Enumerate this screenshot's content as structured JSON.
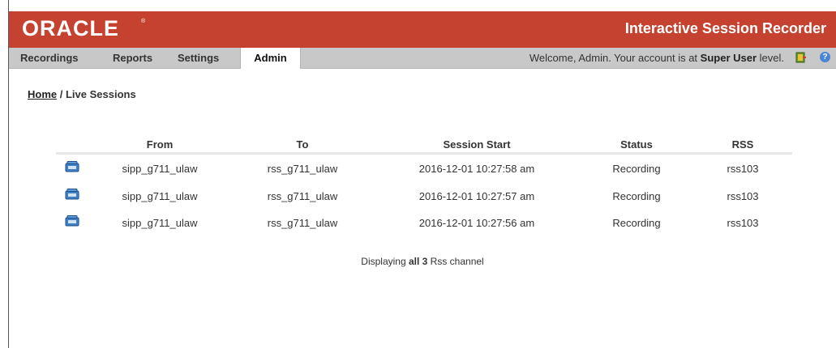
{
  "header": {
    "logo_text": "ORACLE",
    "logo_mark": "®",
    "app_title": "Interactive Session Recorder",
    "brand_color": "#c64230"
  },
  "nav": {
    "tabs": [
      {
        "label": "Recordings",
        "active": false
      },
      {
        "label": "Reports",
        "active": false
      },
      {
        "label": "Settings",
        "active": false
      },
      {
        "label": "Admin",
        "active": true
      }
    ],
    "welcome_prefix": "Welcome, Admin.  Your account is at ",
    "welcome_level": "Super User",
    "welcome_suffix": " level.",
    "logout_icon": "logout-door-icon",
    "help_icon": "help-icon"
  },
  "breadcrumb": {
    "home": "Home",
    "separator": " / ",
    "current": "Live Sessions"
  },
  "table": {
    "columns": [
      "From",
      "To",
      "Session Start",
      "Status",
      "RSS"
    ],
    "row_icon": "phone-icon",
    "rows": [
      {
        "from": "sipp_g711_ulaw",
        "to": "rss_g711_ulaw",
        "start": "2016-12-01 10:27:58 am",
        "status": "Recording",
        "rss": "rss103"
      },
      {
        "from": "sipp_g711_ulaw",
        "to": "rss_g711_ulaw",
        "start": "2016-12-01 10:27:57 am",
        "status": "Recording",
        "rss": "rss103"
      },
      {
        "from": "sipp_g711_ulaw",
        "to": "rss_g711_ulaw",
        "start": "2016-12-01 10:27:56 am",
        "status": "Recording",
        "rss": "rss103"
      }
    ]
  },
  "footer": {
    "prefix": "Displaying ",
    "count": "all 3",
    "suffix": " Rss channel"
  }
}
